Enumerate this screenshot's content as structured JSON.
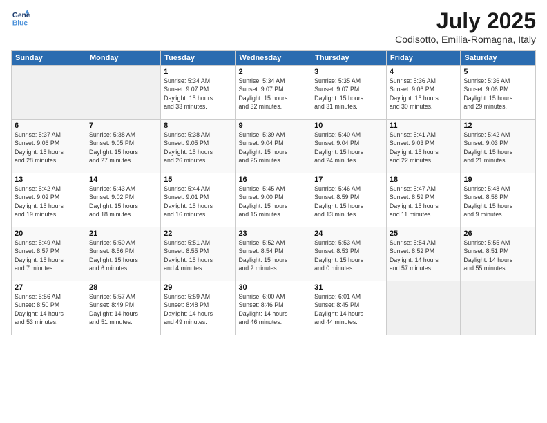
{
  "header": {
    "logo_line1": "General",
    "logo_line2": "Blue",
    "month": "July 2025",
    "location": "Codisotto, Emilia-Romagna, Italy"
  },
  "weekdays": [
    "Sunday",
    "Monday",
    "Tuesday",
    "Wednesday",
    "Thursday",
    "Friday",
    "Saturday"
  ],
  "weeks": [
    [
      {
        "day": "",
        "detail": ""
      },
      {
        "day": "",
        "detail": ""
      },
      {
        "day": "1",
        "detail": "Sunrise: 5:34 AM\nSunset: 9:07 PM\nDaylight: 15 hours\nand 33 minutes."
      },
      {
        "day": "2",
        "detail": "Sunrise: 5:34 AM\nSunset: 9:07 PM\nDaylight: 15 hours\nand 32 minutes."
      },
      {
        "day": "3",
        "detail": "Sunrise: 5:35 AM\nSunset: 9:07 PM\nDaylight: 15 hours\nand 31 minutes."
      },
      {
        "day": "4",
        "detail": "Sunrise: 5:36 AM\nSunset: 9:06 PM\nDaylight: 15 hours\nand 30 minutes."
      },
      {
        "day": "5",
        "detail": "Sunrise: 5:36 AM\nSunset: 9:06 PM\nDaylight: 15 hours\nand 29 minutes."
      }
    ],
    [
      {
        "day": "6",
        "detail": "Sunrise: 5:37 AM\nSunset: 9:06 PM\nDaylight: 15 hours\nand 28 minutes."
      },
      {
        "day": "7",
        "detail": "Sunrise: 5:38 AM\nSunset: 9:05 PM\nDaylight: 15 hours\nand 27 minutes."
      },
      {
        "day": "8",
        "detail": "Sunrise: 5:38 AM\nSunset: 9:05 PM\nDaylight: 15 hours\nand 26 minutes."
      },
      {
        "day": "9",
        "detail": "Sunrise: 5:39 AM\nSunset: 9:04 PM\nDaylight: 15 hours\nand 25 minutes."
      },
      {
        "day": "10",
        "detail": "Sunrise: 5:40 AM\nSunset: 9:04 PM\nDaylight: 15 hours\nand 24 minutes."
      },
      {
        "day": "11",
        "detail": "Sunrise: 5:41 AM\nSunset: 9:03 PM\nDaylight: 15 hours\nand 22 minutes."
      },
      {
        "day": "12",
        "detail": "Sunrise: 5:42 AM\nSunset: 9:03 PM\nDaylight: 15 hours\nand 21 minutes."
      }
    ],
    [
      {
        "day": "13",
        "detail": "Sunrise: 5:42 AM\nSunset: 9:02 PM\nDaylight: 15 hours\nand 19 minutes."
      },
      {
        "day": "14",
        "detail": "Sunrise: 5:43 AM\nSunset: 9:02 PM\nDaylight: 15 hours\nand 18 minutes."
      },
      {
        "day": "15",
        "detail": "Sunrise: 5:44 AM\nSunset: 9:01 PM\nDaylight: 15 hours\nand 16 minutes."
      },
      {
        "day": "16",
        "detail": "Sunrise: 5:45 AM\nSunset: 9:00 PM\nDaylight: 15 hours\nand 15 minutes."
      },
      {
        "day": "17",
        "detail": "Sunrise: 5:46 AM\nSunset: 8:59 PM\nDaylight: 15 hours\nand 13 minutes."
      },
      {
        "day": "18",
        "detail": "Sunrise: 5:47 AM\nSunset: 8:59 PM\nDaylight: 15 hours\nand 11 minutes."
      },
      {
        "day": "19",
        "detail": "Sunrise: 5:48 AM\nSunset: 8:58 PM\nDaylight: 15 hours\nand 9 minutes."
      }
    ],
    [
      {
        "day": "20",
        "detail": "Sunrise: 5:49 AM\nSunset: 8:57 PM\nDaylight: 15 hours\nand 7 minutes."
      },
      {
        "day": "21",
        "detail": "Sunrise: 5:50 AM\nSunset: 8:56 PM\nDaylight: 15 hours\nand 6 minutes."
      },
      {
        "day": "22",
        "detail": "Sunrise: 5:51 AM\nSunset: 8:55 PM\nDaylight: 15 hours\nand 4 minutes."
      },
      {
        "day": "23",
        "detail": "Sunrise: 5:52 AM\nSunset: 8:54 PM\nDaylight: 15 hours\nand 2 minutes."
      },
      {
        "day": "24",
        "detail": "Sunrise: 5:53 AM\nSunset: 8:53 PM\nDaylight: 15 hours\nand 0 minutes."
      },
      {
        "day": "25",
        "detail": "Sunrise: 5:54 AM\nSunset: 8:52 PM\nDaylight: 14 hours\nand 57 minutes."
      },
      {
        "day": "26",
        "detail": "Sunrise: 5:55 AM\nSunset: 8:51 PM\nDaylight: 14 hours\nand 55 minutes."
      }
    ],
    [
      {
        "day": "27",
        "detail": "Sunrise: 5:56 AM\nSunset: 8:50 PM\nDaylight: 14 hours\nand 53 minutes."
      },
      {
        "day": "28",
        "detail": "Sunrise: 5:57 AM\nSunset: 8:49 PM\nDaylight: 14 hours\nand 51 minutes."
      },
      {
        "day": "29",
        "detail": "Sunrise: 5:59 AM\nSunset: 8:48 PM\nDaylight: 14 hours\nand 49 minutes."
      },
      {
        "day": "30",
        "detail": "Sunrise: 6:00 AM\nSunset: 8:46 PM\nDaylight: 14 hours\nand 46 minutes."
      },
      {
        "day": "31",
        "detail": "Sunrise: 6:01 AM\nSunset: 8:45 PM\nDaylight: 14 hours\nand 44 minutes."
      },
      {
        "day": "",
        "detail": ""
      },
      {
        "day": "",
        "detail": ""
      }
    ]
  ]
}
